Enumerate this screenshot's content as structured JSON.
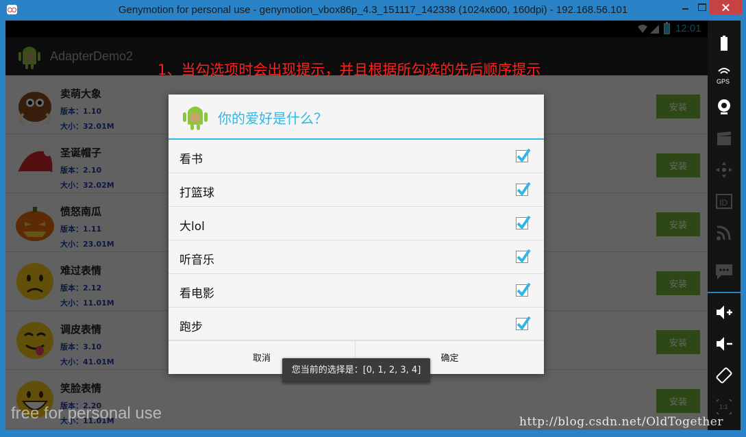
{
  "window": {
    "title": "Genymotion for personal use - genymotion_vbox86p_4.3_151117_142338 (1024x600, 160dpi) - 192.168.56.101"
  },
  "statusbar": {
    "time": "12:01"
  },
  "app": {
    "title": "AdapterDemo2"
  },
  "annotation": "1、当勾选项时会出现提示，并且根据所勾选的先后顺序提示",
  "list": {
    "items": [
      {
        "name": "卖萌大象",
        "version": "版本：1.10",
        "size": "大小：32.01M",
        "button": "安装",
        "icon": "mammoth-icon"
      },
      {
        "name": "圣诞帽子",
        "version": "版本：2.10",
        "size": "大小：32.02M",
        "button": "安装",
        "icon": "santa-hat-icon"
      },
      {
        "name": "愤怒南瓜",
        "version": "版本：1.11",
        "size": "大小：23.01M",
        "button": "安装",
        "icon": "pumpkin-icon"
      },
      {
        "name": "难过表情",
        "version": "版本：2.12",
        "size": "大小：11.01M",
        "button": "安装",
        "icon": "sad-face-icon"
      },
      {
        "name": "调皮表情",
        "version": "版本：3.10",
        "size": "大小：41.01M",
        "button": "安装",
        "icon": "tongue-face-icon"
      },
      {
        "name": "笑脸表情",
        "version": "版本：2.20",
        "size": "大小：11.01M",
        "button": "安装",
        "icon": "smile-face-icon"
      }
    ]
  },
  "dialog": {
    "title": "你的爱好是什么？",
    "options": [
      {
        "label": "看书",
        "checked": true
      },
      {
        "label": "打篮球",
        "checked": true
      },
      {
        "label": "大lol",
        "checked": true
      },
      {
        "label": "听音乐",
        "checked": true
      },
      {
        "label": "看电影",
        "checked": true
      },
      {
        "label": "跑步",
        "checked": true
      }
    ],
    "cancel": "取消",
    "ok": "确定"
  },
  "toast": "您当前的选择是：[0, 1, 2, 3, 4]",
  "watermarks": {
    "left": "free for personal use",
    "right": "http://blog.csdn.net/OldTogether"
  },
  "sidebar": {
    "gps_label": "GPS",
    "id_label": "ID",
    "scale_label": "1:1"
  },
  "colors": {
    "accent": "#33b5e5",
    "install_button": "#74b13b",
    "annotation": "#ff2020",
    "window_frame": "#2a83c6"
  }
}
